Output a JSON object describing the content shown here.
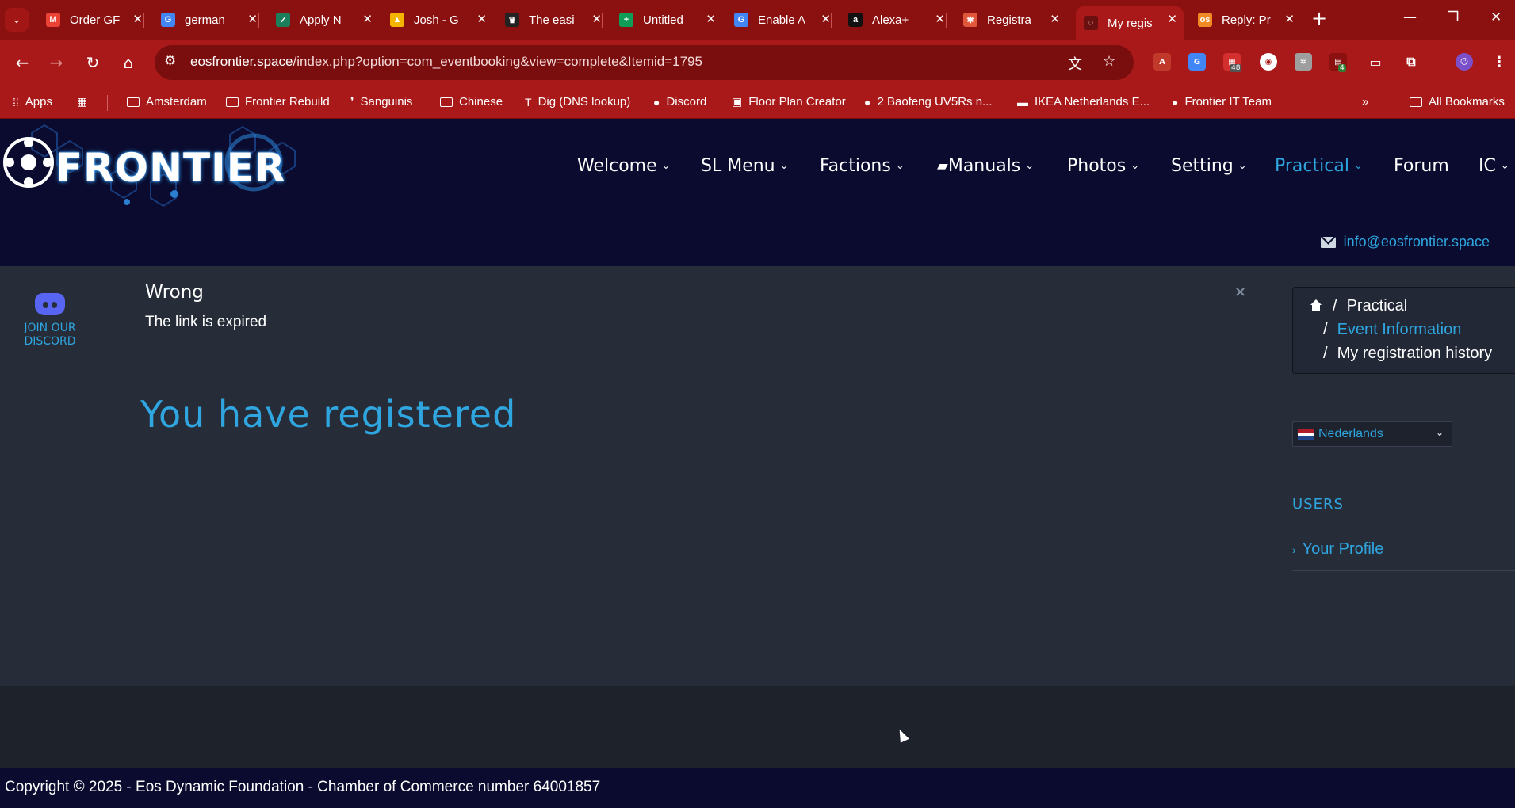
{
  "browser": {
    "tabs": [
      {
        "title": "Order GF",
        "color": "#ea4335",
        "glyph": "M"
      },
      {
        "title": "german",
        "color": "#4285f4",
        "glyph": "G"
      },
      {
        "title": "Apply N",
        "color": "#1a7f5a",
        "glyph": "✓"
      },
      {
        "title": "Josh - G",
        "color": "#f4b400",
        "glyph": "▲"
      },
      {
        "title": "The easi",
        "color": "#222222",
        "glyph": "♛"
      },
      {
        "title": "Untitled",
        "color": "#0f9d58",
        "glyph": "+"
      },
      {
        "title": "Enable A",
        "color": "#4285f4",
        "glyph": "G"
      },
      {
        "title": "Alexa+",
        "color": "#111111",
        "glyph": "a"
      },
      {
        "title": "Registra",
        "color": "#e0573b",
        "glyph": "✱"
      },
      {
        "title": "My regis",
        "color": "#6b1010",
        "glyph": "◌"
      },
      {
        "title": "Reply: Pr",
        "color": "#f08a24",
        "glyph": "os"
      }
    ],
    "active_tab_index": 9,
    "url_host": "eosfrontier.space",
    "url_path": "/index.php?option=com_eventbooking&view=complete&Itemid=1795",
    "extension_badges": [
      "48",
      "4"
    ],
    "bookmarks": [
      {
        "label": "Apps",
        "icon": "apps-icon"
      },
      {
        "label": "",
        "icon": "grid-icon"
      },
      {
        "label": "Amsterdam",
        "icon": "folder-icon"
      },
      {
        "label": "Frontier Rebuild",
        "icon": "folder-icon"
      },
      {
        "label": "Sanguinis",
        "icon": "drop-icon"
      },
      {
        "label": "Chinese",
        "icon": "folder-icon"
      },
      {
        "label": "Dig (DNS lookup)",
        "icon": "t-icon"
      },
      {
        "label": "Discord",
        "icon": "discord-icon"
      },
      {
        "label": "Floor Plan Creator",
        "icon": "plan-icon"
      },
      {
        "label": "2 Baofeng UV5Rs n...",
        "icon": "reddit-icon"
      },
      {
        "label": "IKEA Netherlands E...",
        "icon": "ikea-icon"
      },
      {
        "label": "Frontier IT Team",
        "icon": "github-icon"
      }
    ],
    "all_bookmarks_label": "All Bookmarks"
  },
  "site": {
    "logo_text": "FRONTIER",
    "nav": [
      {
        "label": "Welcome",
        "has_menu": true
      },
      {
        "label": "SL Menu",
        "has_menu": true
      },
      {
        "label": "Factions",
        "has_menu": true
      },
      {
        "label": "Manuals",
        "has_menu": true
      },
      {
        "label": "Photos",
        "has_menu": true
      },
      {
        "label": "Setting",
        "has_menu": true
      },
      {
        "label": "Practical",
        "has_menu": true
      },
      {
        "label": "Forum",
        "has_menu": false
      },
      {
        "label": "IC",
        "has_menu": true
      }
    ],
    "active_nav": "Practical",
    "email": "info@eosfrontier.space",
    "accent_color": "#2fa6e0"
  },
  "main": {
    "discord_label": "JOIN OUR DISCORD",
    "alert_title": "Wrong",
    "alert_message": "The link is expired",
    "alert_close": "×",
    "headline": "You have registered",
    "breadcrumb": {
      "item1": "Practical",
      "item2": "Event Information",
      "item3": "My registration history"
    },
    "language": "Nederlands",
    "users_title": "USERS",
    "profile_link": "Your Profile"
  },
  "footer": {
    "copyright": "Copyright © 2025 - Eos Dynamic Foundation - Chamber of Commerce number 64001857"
  }
}
